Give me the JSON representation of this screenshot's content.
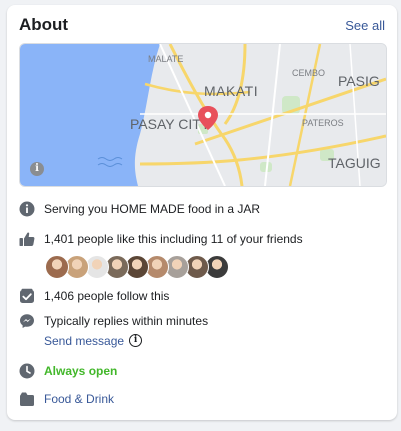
{
  "about": {
    "title": "About",
    "see_all": "See all"
  },
  "map": {
    "labels": [
      "MALATE",
      "MAKATI",
      "CEMBO",
      "PASIG",
      "PASAY CITY",
      "PATEROS",
      "TAGUIG"
    ],
    "info": "i"
  },
  "rows": {
    "description": "Serving you HOME MADE food in a JAR",
    "likes": "1,401 people like this including 11 of your friends",
    "follows": "1,406 people follow this",
    "response": "Typically replies within minutes",
    "send_message": "Send message",
    "hours": "Always open",
    "category": "Food & Drink"
  },
  "friend_avatars": [
    {
      "color": "#9c6b4e"
    },
    {
      "color": "#c9a27a"
    },
    {
      "color": "#e5e5e5"
    },
    {
      "color": "#7a6a5a"
    },
    {
      "color": "#5b4636"
    },
    {
      "color": "#b58a6c"
    },
    {
      "color": "#a7a09a"
    },
    {
      "color": "#6e5a4b"
    },
    {
      "color": "#3b3b3b"
    }
  ],
  "colors": {
    "link": "#385898",
    "open": "#42b72a",
    "pin": "#e8505b",
    "water": "#8ab4f8"
  }
}
